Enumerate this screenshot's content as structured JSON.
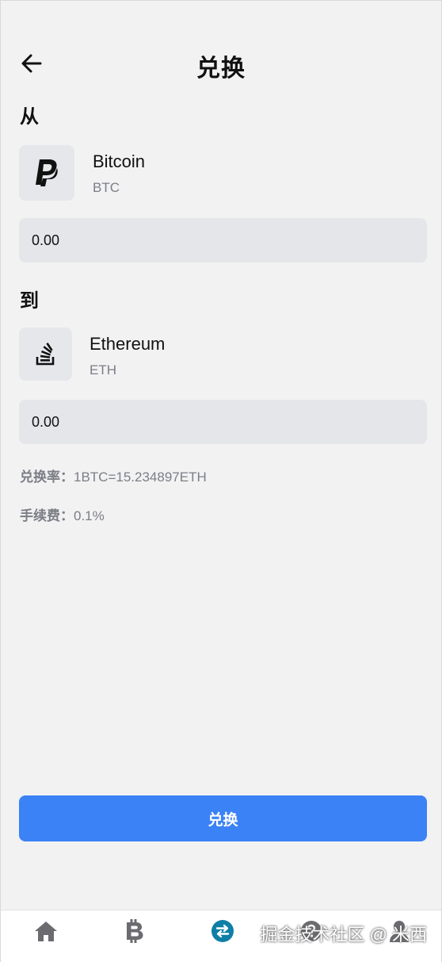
{
  "header": {
    "title": "兑换"
  },
  "from": {
    "label": "从",
    "coin_name": "Bitcoin",
    "coin_symbol": "BTC",
    "icon": "paypal-icon",
    "amount_value": "0.00"
  },
  "to": {
    "label": "到",
    "coin_name": "Ethereum",
    "coin_symbol": "ETH",
    "icon": "stack-overflow-icon",
    "amount_value": "0.00"
  },
  "info": {
    "rate_label": "兑换率：",
    "rate_value": "1BTC=15.234897ETH",
    "fee_label": "手续费：",
    "fee_value": "0.1%"
  },
  "actions": {
    "exchange_label": "兑换"
  },
  "tabbar": {
    "items": [
      {
        "icon": "home-icon",
        "active": false
      },
      {
        "icon": "bitcoin-icon",
        "active": false
      },
      {
        "icon": "exchange-icon",
        "active": true
      },
      {
        "icon": "help-icon",
        "active": false
      },
      {
        "icon": "user-icon",
        "active": false
      }
    ],
    "active_color": "#0e7fa6",
    "inactive_color": "#6b6b70"
  },
  "watermark": "掘金技术社区 @ 米西",
  "colors": {
    "primary": "#3b82f6",
    "background": "#f2f2f3",
    "field": "#e5e6e9"
  }
}
